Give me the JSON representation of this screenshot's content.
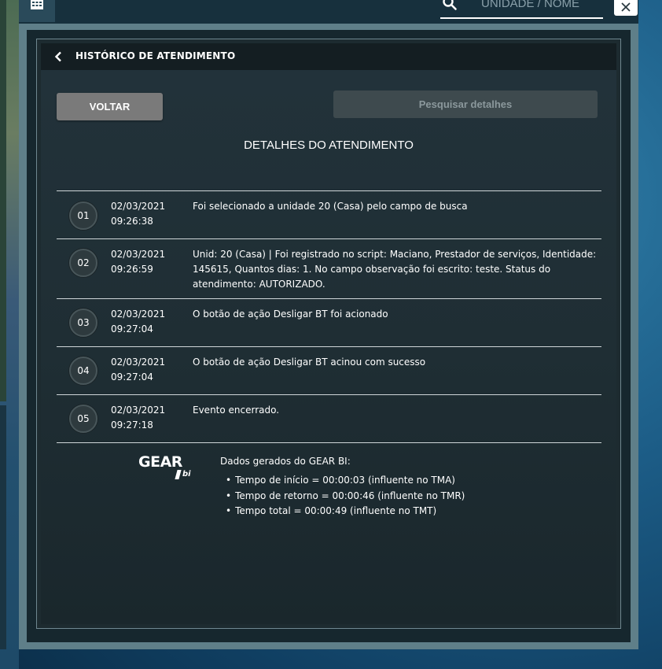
{
  "topbar": {
    "search_placeholder": "UNIDADE / NOME",
    "building_icon": "building-icon",
    "search_icon": "search-icon",
    "close_icon": "close-icon"
  },
  "header": {
    "title": "HISTÓRICO DE ATENDIMENTO",
    "back_icon": "chevron-left-icon"
  },
  "actions": {
    "back_label": "VOLTAR",
    "search_details_label": "Pesquisar detalhes"
  },
  "section_title": "DETALHES DO ATENDIMENTO",
  "events": [
    {
      "num": "01",
      "date": "02/03/2021",
      "time": "09:26:38",
      "text": "Foi selecionado a unidade 20 (Casa) pelo campo de busca"
    },
    {
      "num": "02",
      "date": "02/03/2021",
      "time": "09:26:59",
      "text": "Unid: 20 (Casa) | Foi registrado no script: Maciano, Prestador de serviços, Identidade: 145615, Quantos dias: 1. No campo observação foi escrito: teste. Status do atendimento: AUTORIZADO."
    },
    {
      "num": "03",
      "date": "02/03/2021",
      "time": "09:27:04",
      "text": "O botão de ação Desligar BT foi acionado"
    },
    {
      "num": "04",
      "date": "02/03/2021",
      "time": "09:27:04",
      "text": "O botão de ação Desligar BT acinou com sucesso"
    },
    {
      "num": "05",
      "date": "02/03/2021",
      "time": "09:27:18",
      "text": "Evento encerrado."
    }
  ],
  "gear": {
    "logo_text": "GEAR",
    "logo_sub": "bi",
    "title": "Dados gerados do GEAR BI:",
    "stats": [
      "Tempo de início = 00:00:03 (influente no TMA)",
      "Tempo de retorno = 00:00:46 (influente no TMR)",
      "Tempo total = 00:00:49 (influente no TMT)"
    ]
  },
  "colors": {
    "panel_bg": "#1d2b30",
    "header_bg": "#141e22",
    "back_button": "#7a7a7a",
    "search_button": "#3e4a4e",
    "divider": "#cfd6d8"
  }
}
